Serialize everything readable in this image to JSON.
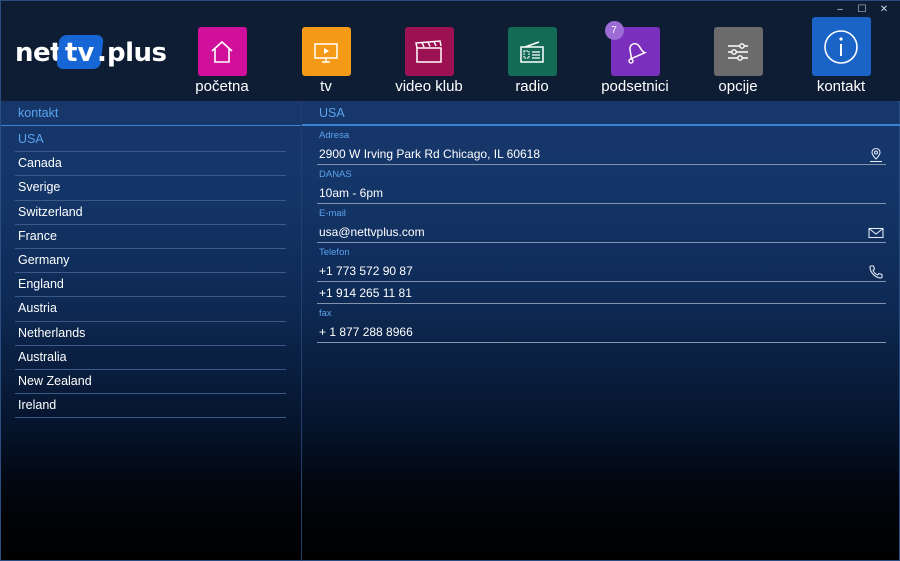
{
  "window": {
    "controls": {
      "minimize": "‒",
      "maximize": "☐",
      "close": "✕"
    }
  },
  "logo": {
    "net": "net",
    "tv": "tv",
    "dot": ".",
    "plus": "plus"
  },
  "nav": {
    "items": [
      {
        "label": "početna",
        "color": "#d0109a",
        "icon": "home-icon"
      },
      {
        "label": "tv",
        "color": "#f59a17",
        "icon": "tv-icon"
      },
      {
        "label": "video klub",
        "color": "#9c1151",
        "icon": "clapperboard-icon"
      },
      {
        "label": "radio",
        "color": "#136b56",
        "icon": "radio-icon"
      },
      {
        "label": "podsetnici",
        "color": "#7b2fbd",
        "icon": "bell-icon",
        "badge": "7"
      },
      {
        "label": "opcije",
        "color": "#6b6b6b",
        "icon": "sliders-icon"
      },
      {
        "label": "kontakt",
        "color": "#1a64c7",
        "icon": "info-icon",
        "active": true
      }
    ]
  },
  "left_panel": {
    "title": "kontakt",
    "countries": [
      "USA",
      "Canada",
      "Sverige",
      "Switzerland",
      "France",
      "Germany",
      "England",
      "Austria",
      "Netherlands",
      "Australia",
      "New Zealand",
      "Ireland"
    ],
    "selected": "USA"
  },
  "right_panel": {
    "title": "USA",
    "address_label": "Adresa",
    "address": "2900 W Irving Park Rd Chicago, IL 60618",
    "hours_label": "DANAS",
    "hours": "10am - 6pm",
    "email_label": "E-mail",
    "email": "usa@nettvplus.com",
    "phone_label": "Telefon",
    "phone1": "+1 773 572 90 87",
    "phone2": "+1 914 265 11 81",
    "fax_label": "fax",
    "fax": "+ 1 877 288 8966"
  },
  "colors": {
    "accent": "#5aa3ee",
    "header_bg": "#0e1d34",
    "logo_blue": "#1666d6"
  }
}
